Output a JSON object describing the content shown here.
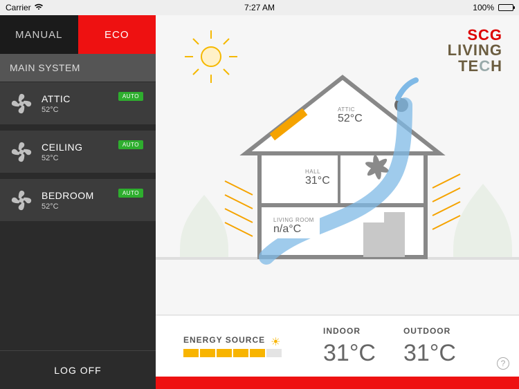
{
  "statusbar": {
    "carrier": "Carrier",
    "wifi_icon": "wifi",
    "time": "7:27 AM",
    "battery_pct": "100%"
  },
  "logo": {
    "line1": "SCG",
    "line2": "LIVING",
    "line3_a": "TE",
    "line3_b": "C",
    "line3_c": "H"
  },
  "sidebar": {
    "tabs": {
      "manual": "MANUAL",
      "eco": "ECO",
      "activeIndex": 1
    },
    "sectionHeader": "MAIN SYSTEM",
    "zones": [
      {
        "name": "ATTIC",
        "temp": "52°C",
        "badge": "AUTO"
      },
      {
        "name": "CEILING",
        "temp": "52°C",
        "badge": "AUTO"
      },
      {
        "name": "BEDROOM",
        "temp": "52°C",
        "badge": "AUTO"
      }
    ],
    "logoff": "LOG OFF",
    "collapse": "‹"
  },
  "diagram": {
    "attic": {
      "label": "ATTIC",
      "temp": "52°C"
    },
    "hall": {
      "label": "HALL",
      "temp": "31°C"
    },
    "livingroom": {
      "label": "LIVING ROOM",
      "temp": "n/a°C"
    }
  },
  "stats": {
    "energyLabel": "ENERGY SOURCE",
    "energySegments": 6,
    "energyOn": 5,
    "indoor": {
      "label": "INDOOR",
      "value": "31°C"
    },
    "outdoor": {
      "label": "OUTDOOR",
      "value": "31°C"
    }
  },
  "icons": {
    "help": "?"
  }
}
